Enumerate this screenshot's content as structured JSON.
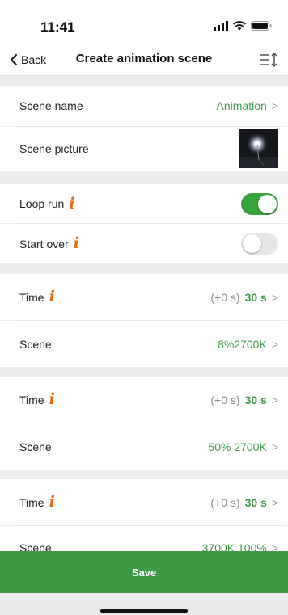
{
  "status": {
    "time": "11:41"
  },
  "nav": {
    "back_label": "Back",
    "title": "Create animation scene"
  },
  "scene": {
    "name_label": "Scene name",
    "name_value": "Animation",
    "picture_label": "Scene picture"
  },
  "toggles": {
    "loop_label": "Loop run",
    "loop_on": true,
    "start_over_label": "Start over",
    "start_over_on": false
  },
  "steps": [
    {
      "time_label": "Time",
      "offset": "(+0 s)",
      "duration": "30 s",
      "scene_label": "Scene",
      "scene_value": "8%2700K"
    },
    {
      "time_label": "Time",
      "offset": "(+0 s)",
      "duration": "30 s",
      "scene_label": "Scene",
      "scene_value": "50% 2700K"
    },
    {
      "time_label": "Time",
      "offset": "(+0 s)",
      "duration": "30 s",
      "scene_label": "Scene",
      "scene_value": "3700K 100%"
    }
  ],
  "save_label": "Save",
  "colors": {
    "accent_green": "#3e9a48",
    "info_orange": "#e36a12"
  },
  "icons": {
    "info": "info-icon",
    "sort": "sort-icon",
    "back": "chevron-left-icon"
  }
}
